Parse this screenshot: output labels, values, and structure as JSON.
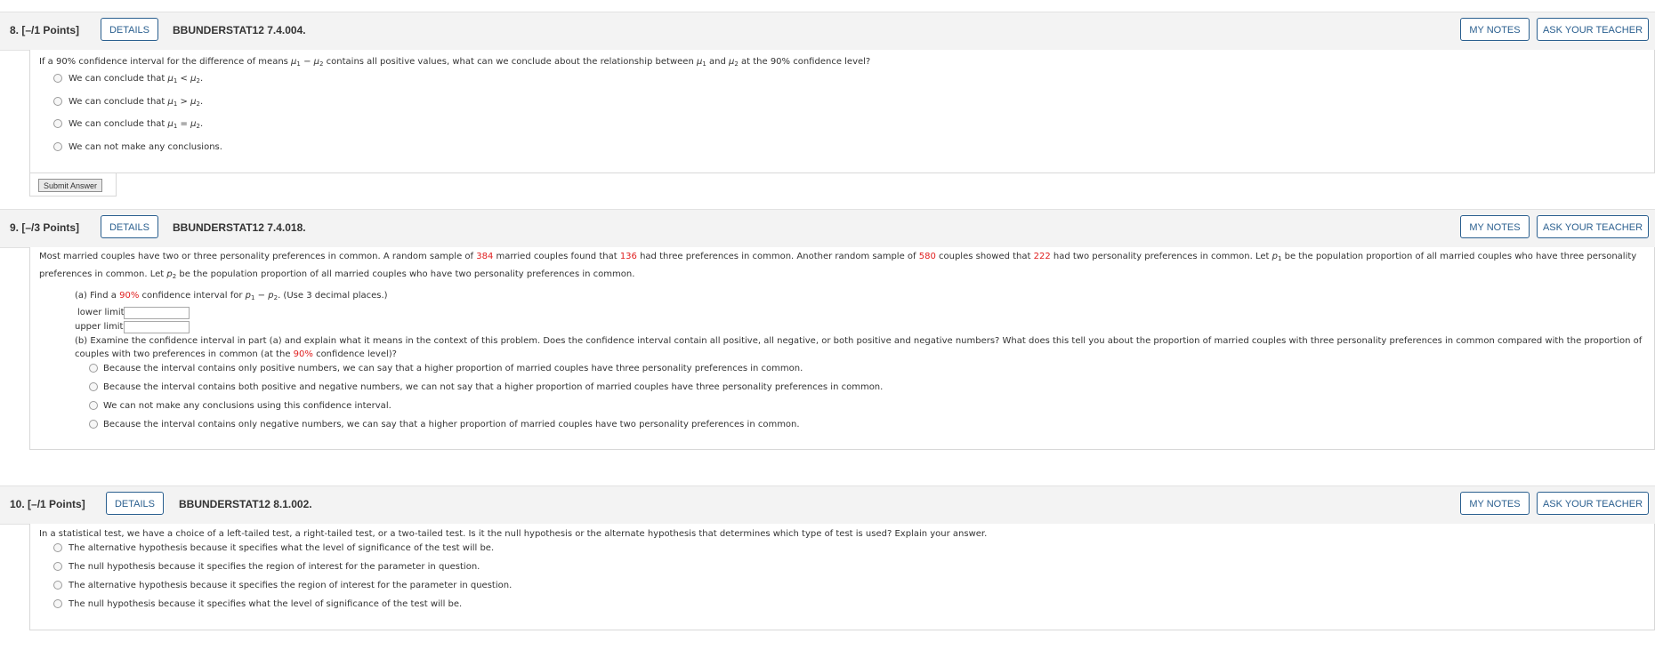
{
  "buttons": {
    "details": "DETAILS",
    "my_notes": "MY NOTES",
    "ask_teacher": "ASK YOUR TEACHER",
    "submit": "Submit Answer"
  },
  "q8": {
    "number": "8.",
    "points": "[–/1 Points]",
    "code": "BBUNDERSTAT12 7.4.004.",
    "prompt_a": "If a 90% confidence interval for the difference of means ",
    "mu": "μ",
    "sub1": "1",
    "sub2": "2",
    "minus": " − ",
    "prompt_b": " contains all positive values, what can we conclude about the relationship between ",
    "and": " and ",
    "prompt_c": " at the 90% confidence level?",
    "opt_prefix": "We can conclude that ",
    "lt": " < ",
    "gt": " > ",
    "eq": " = ",
    "dot": ".",
    "opt4": "We can not make any conclusions."
  },
  "q9": {
    "number": "9.",
    "points": "[–/3 Points]",
    "code": "BBUNDERSTAT12 7.4.018.",
    "p1a": "Most married couples have two or three personality preferences in common. A random sample of ",
    "n1": "384",
    "p1b": " married couples found that ",
    "x1": "136",
    "p1c": " had three preferences in common. Another random sample of ",
    "n2": "580",
    "p1d": " couples showed that ",
    "x2": "222",
    "p1e": " had two personality preferences in common. Let ",
    "p": "p",
    "p1f": " be the population proportion of all married couples who have three personality",
    "p2a": "preferences in common. Let ",
    "p2b": " be the population proportion of all married couples who have two personality preferences in common.",
    "a_prefix": "(a) Find a ",
    "conf": "90%",
    "a_mid": " confidence interval for ",
    "a_suffix": ". (Use 3 decimal places.)",
    "lower": "lower limit",
    "upper": "upper limit",
    "b_line1": "(b) Examine the confidence interval in part (a) and explain what it means in the context of this problem. Does the confidence interval contain all positive, all negative, or both positive and negative numbers? What does this tell you about the proportion of married couples with three personality preferences in common compared with the proportion of",
    "b_line2a": "couples with two preferences in common (at the ",
    "b_line2b": " confidence level)?",
    "options": [
      "Because the interval contains only positive numbers, we can say that a higher proportion of married couples have three personality preferences in common.",
      "Because the interval contains both positive and negative numbers, we can not say that a higher proportion of married couples have three personality preferences in common.",
      "We can not make any conclusions using this confidence interval.",
      "Because the interval contains only negative numbers, we can say that a higher proportion of married couples have two personality preferences in common."
    ]
  },
  "q10": {
    "number": "10.",
    "points": "[–/1 Points]",
    "code": "BBUNDERSTAT12 8.1.002.",
    "prompt": "In a statistical test, we have a choice of a left-tailed test, a right-tailed test, or a two-tailed test. Is it the null hypothesis or the alternate hypothesis that determines which type of test is used? Explain your answer.",
    "options": [
      "The alternative hypothesis because it specifies what the level of significance of the test will be.",
      "The null hypothesis because it specifies the region of interest for the parameter in question.",
      "The alternative hypothesis because it specifies the region of interest for the parameter in question.",
      "The null hypothesis because it specifies what the level of significance of the test will be."
    ]
  }
}
